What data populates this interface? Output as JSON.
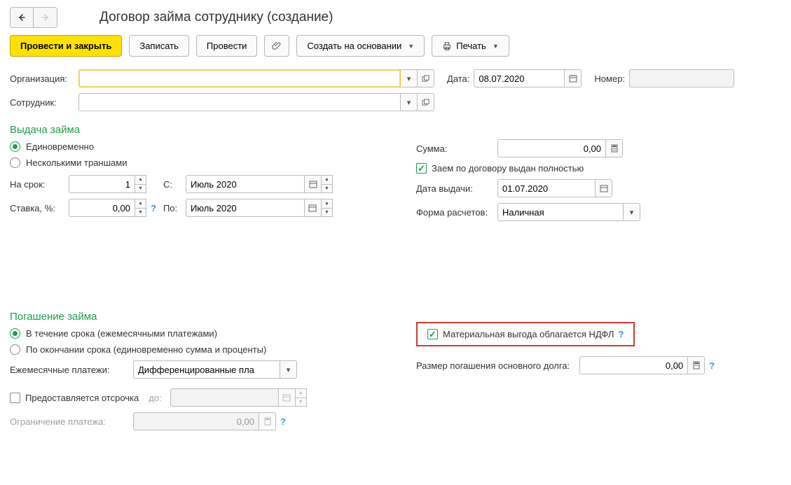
{
  "header": {
    "title": "Договор займа сотруднику (создание)"
  },
  "toolbar": {
    "post_close": "Провести и закрыть",
    "save": "Записать",
    "post": "Провести",
    "create_based": "Создать на основании",
    "print": "Печать"
  },
  "fields": {
    "org_label": "Организация:",
    "org_value": "",
    "date_label": "Дата:",
    "date_value": "08.07.2020",
    "number_label": "Номер:",
    "number_value": "",
    "employee_label": "Сотрудник:",
    "employee_value": ""
  },
  "issuance": {
    "title": "Выдача займа",
    "once": "Единовременно",
    "tranches": "Несколькими траншами",
    "term_label": "На срок:",
    "term_value": "1",
    "from_label": "С:",
    "from_value": "Июль 2020",
    "rate_label": "Ставка, %:",
    "rate_value": "0,00",
    "to_label": "По:",
    "to_value": "Июль 2020",
    "sum_label": "Сумма:",
    "sum_value": "0,00",
    "fully_issued": "Заем по договору выдан полностью",
    "issue_date_label": "Дата выдачи:",
    "issue_date_value": "01.07.2020",
    "settlement_label": "Форма расчетов:",
    "settlement_value": "Наличная"
  },
  "repayment": {
    "title": "Погашение займа",
    "during": "В течение срока (ежемесячными платежами)",
    "at_end": "По окончании срока (единовременно сумма и проценты)",
    "monthly_label": "Ежемесячные платежи:",
    "monthly_value": "Дифференцированные пла",
    "deferral": "Предоставляется отсрочка",
    "deferral_to": "до:",
    "deferral_value": "",
    "limit_label": "Ограничение платежа:",
    "limit_value": "0,00",
    "ndfl": "Материальная выгода облагается НДФЛ",
    "principal_label": "Размер погашения основного долга:",
    "principal_value": "0,00"
  }
}
